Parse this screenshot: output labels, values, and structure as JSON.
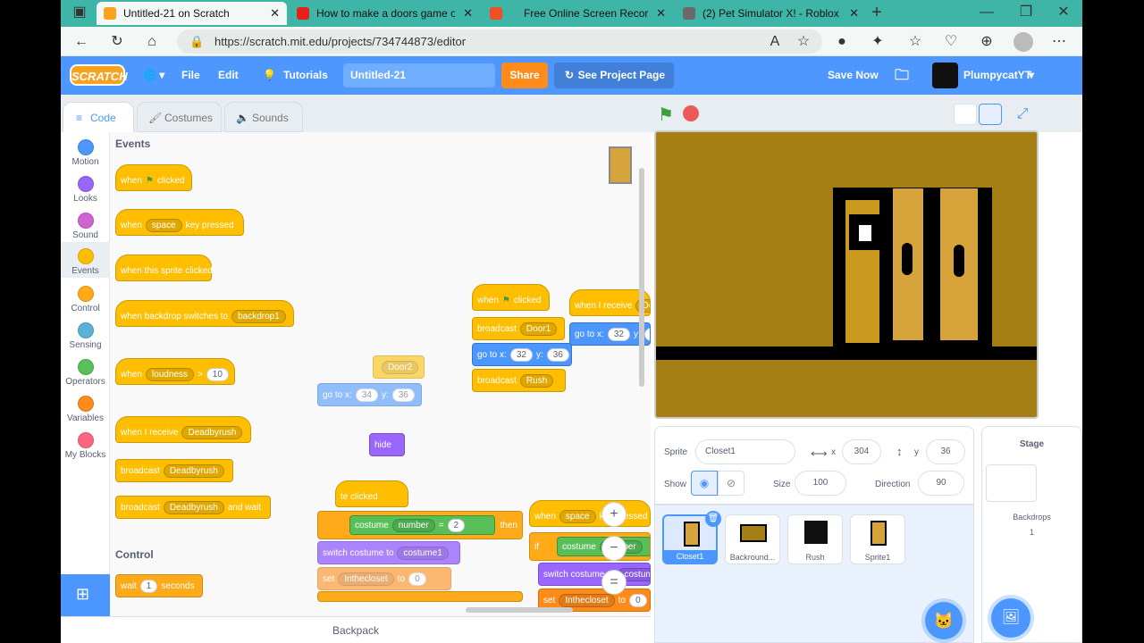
{
  "browser": {
    "tabs": [
      {
        "title": "Untitled-21 on Scratch",
        "color": "#f7a320"
      },
      {
        "title": "How to make a doors game on s",
        "color": "#e62117"
      },
      {
        "title": "Free Online Screen Recorder",
        "color": "#f04e23"
      },
      {
        "title": "(2) Pet Simulator X! - Roblox",
        "color": "#6a6a6a"
      }
    ],
    "new_tab": "+",
    "url": "https://scratch.mit.edu/projects/734744873/editor"
  },
  "menubar": {
    "logo": "SCRATCH",
    "file": "File",
    "edit": "Edit",
    "tutorials": "Tutorials",
    "project_title": "Untitled-21",
    "share": "Share",
    "see_project": "See Project Page",
    "save_now": "Save Now",
    "username": "PlumpycatYT"
  },
  "editor_tabs": {
    "code": "Code",
    "costumes": "Costumes",
    "sounds": "Sounds"
  },
  "categories": [
    {
      "label": "Motion",
      "color": "#4c97ff"
    },
    {
      "label": "Looks",
      "color": "#9966ff"
    },
    {
      "label": "Sound",
      "color": "#cf63cf"
    },
    {
      "label": "Events",
      "color": "#ffbf00"
    },
    {
      "label": "Control",
      "color": "#ffab19"
    },
    {
      "label": "Sensing",
      "color": "#5cb1d6"
    },
    {
      "label": "Operators",
      "color": "#59c059"
    },
    {
      "label": "Variables",
      "color": "#ff8c1a"
    },
    {
      "label": "My Blocks",
      "color": "#ff6680"
    }
  ],
  "palette": {
    "events_heading": "Events",
    "control_heading": "Control",
    "when": "when",
    "clicked": "clicked",
    "space": "space",
    "key_pressed": "key pressed",
    "when_sprite_clicked": "when this sprite clicked",
    "when_backdrop_switches": "when backdrop switches to",
    "backdrop1": "backdrop1",
    "loudness": "loudness",
    "gt": ">",
    "ten": "10",
    "when_i_receive": "when I receive",
    "deadbyrush": "Deadbyrush",
    "broadcast": "broadcast",
    "and_wait": "and wait",
    "wait": "wait",
    "one": "1",
    "seconds": "seconds"
  },
  "workspace": {
    "door2": "Door2",
    "go_to_x": "go to x:",
    "x34": "34",
    "y": "y:",
    "y36": "36",
    "hide": "hide",
    "sprite_clicked": "te clicked",
    "costume": "costume",
    "number": "number",
    "eq": "=",
    "two": "2",
    "then": "then",
    "switch_costume_to": "switch costume to",
    "costume1": "costume1",
    "set": "set",
    "inthecloset": "Inthecloset",
    "to": "to",
    "zero": "0",
    "when_flag_clicked_when": "when",
    "when_flag_clicked_clicked": "clicked",
    "door1": "Door1",
    "x32": "32",
    "rush": "Rush",
    "when_i_receive": "when I receive",
    "when_space_pressed": "key pressed",
    "if": "if",
    "zoom_in": "+",
    "zoom_out": "−",
    "reset": "=",
    "backpack": "Backpack"
  },
  "sprite_info": {
    "sprite_label": "Sprite",
    "sprite_name": "Closet1",
    "x_label": "x",
    "x_value": "304",
    "y_label": "y",
    "y_value": "36",
    "show_label": "Show",
    "size_label": "Size",
    "size_value": "100",
    "direction_label": "Direction",
    "direction_value": "90"
  },
  "sprites": [
    {
      "name": "Closet1"
    },
    {
      "name": "Backround..."
    },
    {
      "name": "Rush"
    },
    {
      "name": "Sprite1"
    }
  ],
  "stage_panel": {
    "title": "Stage",
    "backdrops_label": "Backdrops",
    "backdrops_count": "1"
  }
}
